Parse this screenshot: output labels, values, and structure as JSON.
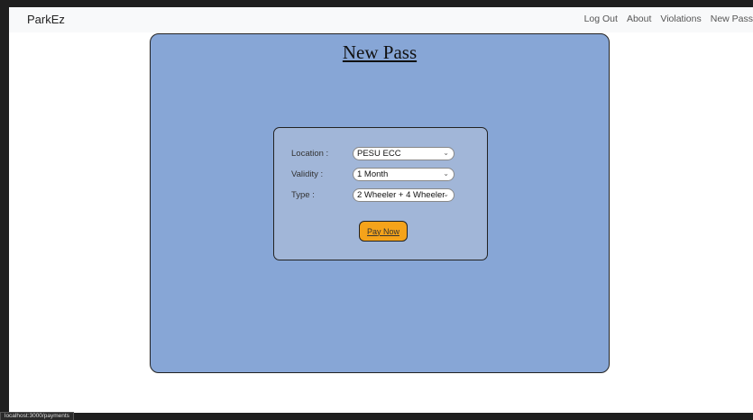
{
  "navbar": {
    "brand": "ParkEz",
    "links": [
      "Log Out",
      "About",
      "Violations",
      "New Pass"
    ]
  },
  "page": {
    "title": "New Pass"
  },
  "form": {
    "location_label": "Location :",
    "location_value": "PESU ECC",
    "validity_label": "Validity :",
    "validity_value": "1 Month",
    "type_label": "Type :",
    "type_value": "2 Wheeler + 4 Wheeler",
    "pay_button": "Pay Now"
  },
  "status_bar": {
    "url": "localhost:3000/payments"
  },
  "colors": {
    "panel": "#87a6d6",
    "card": "#a1b6d8",
    "button": "#f5a31a"
  }
}
